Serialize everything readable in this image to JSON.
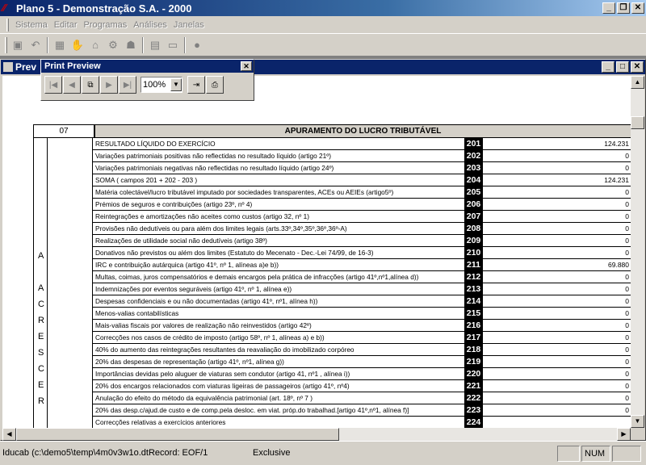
{
  "app": {
    "title": "Plano 5 - Demonstração S.A. - 2000"
  },
  "menu": [
    "Sistema",
    "Editar",
    "Programas",
    "Análises",
    "Janelas"
  ],
  "child": {
    "title": "Prev"
  },
  "print_preview": {
    "title": "Print Preview",
    "zoom": "100%"
  },
  "report": {
    "section_number": "07",
    "section_title": "APURAMENTO DO LUCRO TRIBUTÁVEL",
    "side_letters": [
      "A",
      "A",
      "C",
      "R",
      "E",
      "S",
      "C",
      "E",
      "R"
    ],
    "rows": [
      {
        "desc": "RESULTADO LÍQUIDO DO EXERCÍCIO",
        "code": "201",
        "value": "124.231"
      },
      {
        "desc": "Variações patrimoniais positivas não reflectidas no resultado líquido (artigo 21º)",
        "code": "202",
        "value": "0"
      },
      {
        "desc": "Variações patrimoniais negativas não reflectidas no resultado líquido (artigo 24º)",
        "code": "203",
        "value": "0"
      },
      {
        "desc": "SOMA ( campos 201 + 202 - 203 )",
        "code": "204",
        "value": "124.231"
      },
      {
        "desc": "Matéria colectável/lucro tributável imputado por sociedades transparentes, ACEs ou AEIEs (artigo5º)",
        "code": "205",
        "value": "0"
      },
      {
        "desc": "Prémios de seguros e contribuições (artigo 23º, nº 4)",
        "code": "206",
        "value": "0"
      },
      {
        "desc": "Reintegrações e amortizações não aceites como custos (artigo 32, nº 1)",
        "code": "207",
        "value": "0"
      },
      {
        "desc": "Provisões não dedutíveis ou para além dos limites legais (arts.33º,34º,35º,36º,36º-A)",
        "code": "208",
        "value": "0"
      },
      {
        "desc": "Realizações de utilidade social não dedutíveis (artigo 38º)",
        "code": "209",
        "value": "0"
      },
      {
        "desc": "Donativos não previstos ou além dos limites (Estatuto do Mecenato - Dec.-Lei 74/99, de 16-3)",
        "code": "210",
        "value": "0"
      },
      {
        "desc": "IRC e contribuição autárquica (artigo 41º, nº 1, alíneas a)e b))",
        "code": "211",
        "value": "69.880"
      },
      {
        "desc": "Multas, coimas, juros compensatórios e demais encargos pela prática de infracções (artigo 41º,nº1,alínea d))",
        "code": "212",
        "value": "0"
      },
      {
        "desc": "Indemnizações por eventos seguráveis (artigo 41º, nº 1, alínea e))",
        "code": "213",
        "value": "0"
      },
      {
        "desc": "Despesas confidenciais e ou não documentadas (artigo 41º, nº1, alínea h))",
        "code": "214",
        "value": "0"
      },
      {
        "desc": "Menos-valias contabilísticas",
        "code": "215",
        "value": "0"
      },
      {
        "desc": "Mais-valias fiscais por valores de realização não reinvestidos (artigo 42º)",
        "code": "216",
        "value": "0"
      },
      {
        "desc": "Correcções nos casos de crédito de imposto (artigo 58º, nº 1, alíneas a) e b))",
        "code": "217",
        "value": "0"
      },
      {
        "desc": "40% do aumento das reintegrações resultantes da reavaliação do imobilizado corpóreo",
        "code": "218",
        "value": "0"
      },
      {
        "desc": "20% das despesas de representação (artigo 41º, nº1, alínea g))",
        "code": "219",
        "value": "0"
      },
      {
        "desc": "Importâncias devidas pelo aluguer de viaturas sem condutor (artigo 41, nº1 , alínea i))",
        "code": "220",
        "value": "0"
      },
      {
        "desc": "20% dos encargos relacionados com viaturas ligeiras de passageiros (artigo 41º, nº4)",
        "code": "221",
        "value": "0"
      },
      {
        "desc": "Anulação do efeito do método da equivalência patrimonial (art. 18º, nº 7 )",
        "code": "222",
        "value": "0"
      },
      {
        "desc": "20% das desp.c/ajud.de custo e de comp.pela desloc. em viat. próp.do trabalhad.[artigo 41º,nº1, alínea f)]",
        "code": "223",
        "value": "0"
      },
      {
        "desc": "Correcções relativas a exercícios anteriores",
        "code": "224",
        "value": ""
      }
    ]
  },
  "status": {
    "left": "Iducab (c:\\demo5\\temp\\4m0v3w1o.dtRecord: EOF/1",
    "mode": "Exclusive",
    "num": "NUM"
  }
}
